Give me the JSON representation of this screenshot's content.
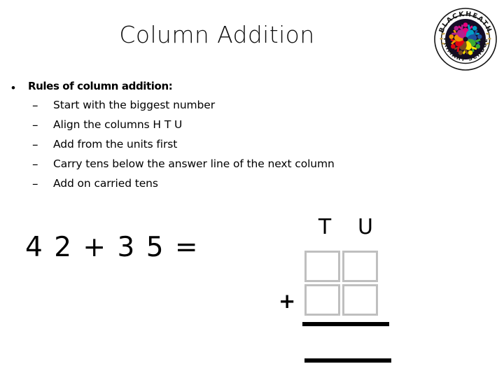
{
  "slide": {
    "title": "Column Addition",
    "bullets": [
      {
        "level": 1,
        "marker": "•",
        "text": "Rules of column addition:"
      },
      {
        "level": 2,
        "marker": "–",
        "text": "Start with the biggest number"
      },
      {
        "level": 2,
        "marker": "–",
        "text": "Align the columns H T U"
      },
      {
        "level": 2,
        "marker": "–",
        "text": "Add from the units first"
      },
      {
        "level": 2,
        "marker": "–",
        "text": "Carry tens below the answer line of the next column"
      },
      {
        "level": 2,
        "marker": "–",
        "text": "Add on carried tens"
      }
    ],
    "equation": "4 2 + 3 5 =",
    "column_addition": {
      "headers": [
        "T",
        "U"
      ],
      "rows": [
        {
          "cells": [
            "",
            ""
          ],
          "operator": ""
        },
        {
          "cells": [
            "",
            ""
          ],
          "operator": "+"
        }
      ],
      "answer_line": true,
      "total_line": true,
      "cell_border_color": "#bfbfbf",
      "rule_color": "#000000"
    },
    "logo": {
      "name": "blackheath-primary-school-logo",
      "top_arc_text": "BLACKHEATH",
      "bottom_arc_text": "PRIMARY SCHOOL",
      "ring_background": "#ffffff",
      "disc_color": "#140c26",
      "figure_colors": [
        "#e6007e",
        "#f39200",
        "#ffe400",
        "#3aaa35",
        "#00a0c6",
        "#1d4fa0",
        "#7b4b1e",
        "#e30613",
        "#b51f8e"
      ]
    },
    "colors": {
      "text": "#000000",
      "background": "#ffffff",
      "grid_border": "#bfbfbf"
    }
  }
}
